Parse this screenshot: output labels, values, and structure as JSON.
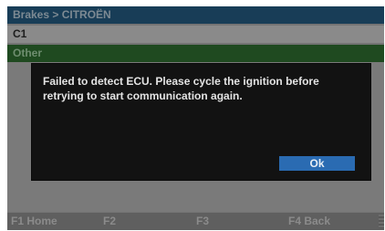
{
  "header": {
    "breadcrumb": "Brakes > CITROËN",
    "model": "C1",
    "category": "Other"
  },
  "dialog": {
    "message": "Failed to detect ECU. Please cycle the ignition before retrying to start communication again.",
    "ok_label": "Ok"
  },
  "function_bar": {
    "f1": "F1 Home",
    "f2": "F2",
    "f3": "F3",
    "f4": "F4 Back"
  },
  "colors": {
    "breadcrumb_bar": "#183d57",
    "category_bar": "#1f4a20",
    "dialog_background": "#121212",
    "ok_button": "#2a6bb2"
  }
}
